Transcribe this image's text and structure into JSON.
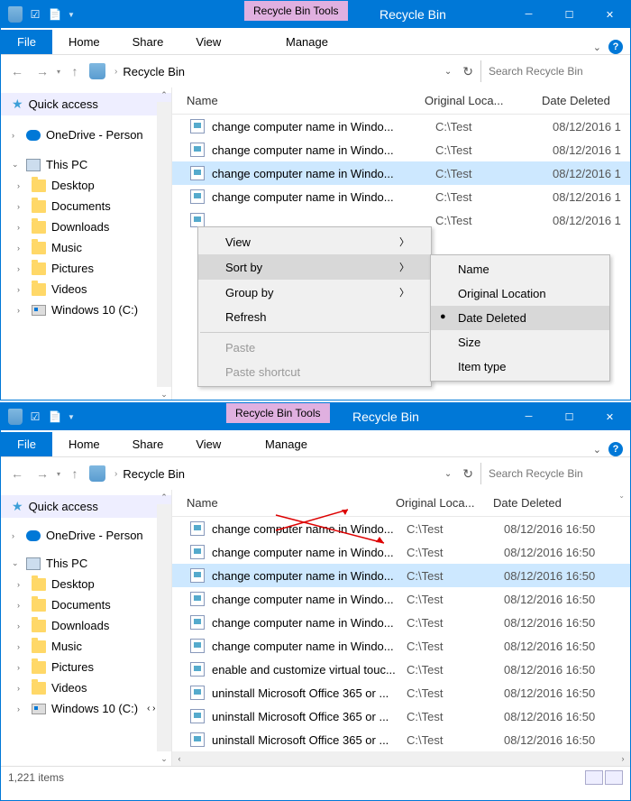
{
  "window1": {
    "contextual_tab": "Recycle Bin Tools",
    "title": "Recycle Bin",
    "ribbon": {
      "file": "File",
      "tabs": [
        "Home",
        "Share",
        "View"
      ],
      "manage": "Manage"
    },
    "breadcrumb": "Recycle Bin",
    "search_placeholder": "Search Recycle Bin",
    "columns": {
      "name": "Name",
      "loc": "Original Loca...",
      "date": "Date Deleted"
    },
    "files": [
      {
        "name": "change computer name in Windo...",
        "loc": "C:\\Test",
        "date": "08/12/2016 1"
      },
      {
        "name": "change computer name in Windo...",
        "loc": "C:\\Test",
        "date": "08/12/2016 1"
      },
      {
        "name": "change computer name in Windo...",
        "loc": "C:\\Test",
        "date": "08/12/2016 1",
        "selected": true
      },
      {
        "name": "change computer name in Windo...",
        "loc": "C:\\Test",
        "date": "08/12/2016 1"
      },
      {
        "name": "",
        "loc": "C:\\Test",
        "date": "08/12/2016 1"
      }
    ],
    "context_menu": {
      "items": [
        {
          "label": "View",
          "submenu": true
        },
        {
          "label": "Sort by",
          "submenu": true,
          "hover": true
        },
        {
          "label": "Group by",
          "submenu": true
        },
        {
          "label": "Refresh"
        },
        {
          "sep": true
        },
        {
          "label": "Paste",
          "disabled": true
        },
        {
          "label": "Paste shortcut",
          "disabled": true
        }
      ],
      "submenu": {
        "items": [
          {
            "label": "Name"
          },
          {
            "label": "Original Location"
          },
          {
            "label": "Date Deleted",
            "selected": true
          },
          {
            "label": "Size"
          },
          {
            "label": "Item type"
          }
        ]
      }
    }
  },
  "window2": {
    "contextual_tab": "Recycle Bin Tools",
    "title": "Recycle Bin",
    "ribbon": {
      "file": "File",
      "tabs": [
        "Home",
        "Share",
        "View"
      ],
      "manage": "Manage"
    },
    "breadcrumb": "Recycle Bin",
    "search_placeholder": "Search Recycle Bin",
    "columns": {
      "name": "Name",
      "loc": "Original Loca...",
      "date": "Date Deleted"
    },
    "files": [
      {
        "name": "change computer name in Windo...",
        "loc": "C:\\Test",
        "date": "08/12/2016 16:50"
      },
      {
        "name": "change computer name in Windo...",
        "loc": "C:\\Test",
        "date": "08/12/2016 16:50"
      },
      {
        "name": "change computer name in Windo...",
        "loc": "C:\\Test",
        "date": "08/12/2016 16:50",
        "selected": true
      },
      {
        "name": "change computer name in Windo...",
        "loc": "C:\\Test",
        "date": "08/12/2016 16:50"
      },
      {
        "name": "change computer name in Windo...",
        "loc": "C:\\Test",
        "date": "08/12/2016 16:50"
      },
      {
        "name": "change computer name in Windo...",
        "loc": "C:\\Test",
        "date": "08/12/2016 16:50"
      },
      {
        "name": "enable and customize virtual touc...",
        "loc": "C:\\Test",
        "date": "08/12/2016 16:50"
      },
      {
        "name": "uninstall Microsoft Office 365 or ...",
        "loc": "C:\\Test",
        "date": "08/12/2016 16:50"
      },
      {
        "name": "uninstall Microsoft Office 365 or ...",
        "loc": "C:\\Test",
        "date": "08/12/2016 16:50"
      },
      {
        "name": "uninstall Microsoft Office 365 or ...",
        "loc": "C:\\Test",
        "date": "08/12/2016 16:50"
      }
    ],
    "status": "1,221 items"
  },
  "sidebar": {
    "quick": "Quick access",
    "onedrive": "OneDrive - Person",
    "thispc": "This PC",
    "folders": [
      "Desktop",
      "Documents",
      "Downloads",
      "Music",
      "Pictures",
      "Videos"
    ],
    "drive": "Windows 10 (C:)"
  }
}
